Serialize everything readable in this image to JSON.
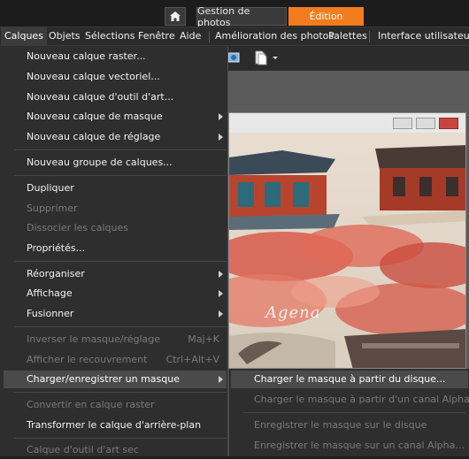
{
  "workspace_tabs": {
    "home_icon": "home-icon",
    "gestion": "Gestion de photos",
    "edition": "Édition"
  },
  "menubar": {
    "items": [
      "Calques",
      "Objets",
      "Sélections",
      "Fenêtre",
      "Aide",
      "Amélioration des photos",
      "Palettes",
      "Interface utilisateur"
    ]
  },
  "calques_menu": {
    "items": [
      {
        "label": "Nouveau calque raster..."
      },
      {
        "label": "Nouveau calque vectoriel..."
      },
      {
        "label": "Nouveau calque d'outil d'art..."
      },
      {
        "label": "Nouveau calque de masque"
      },
      {
        "label": "Nouveau calque de réglage"
      },
      {
        "label": "Nouveau groupe de calques..."
      },
      {
        "label": "Dupliquer"
      },
      {
        "label": "Supprimer"
      },
      {
        "label": "Dissocier les calques"
      },
      {
        "label": "Propriétés..."
      },
      {
        "label": "Réorganiser"
      },
      {
        "label": "Affichage"
      },
      {
        "label": "Fusionner"
      },
      {
        "label": "Inverser le masque/réglage",
        "shortcut": "Maj+K"
      },
      {
        "label": "Afficher le recouvrement",
        "shortcut": "Ctrl+Alt+V"
      },
      {
        "label": "Charger/enregistrer un masque"
      },
      {
        "label": "Convertir en calque raster"
      },
      {
        "label": "Transformer le calque d'arrière-plan"
      },
      {
        "label": "Calque d'outil d'art sec"
      }
    ]
  },
  "mask_submenu": {
    "items": [
      {
        "label": "Charger le masque à partir du disque..."
      },
      {
        "label": "Charger le masque à partir d'un canal Alpha..."
      },
      {
        "label": "Enregistrer le masque sur le disque"
      },
      {
        "label": "Enregistrer le masque sur un canal Alpha..."
      }
    ]
  },
  "image": {
    "watermark": "Agena",
    "title_buttons": [
      "minimize-icon",
      "restore-icon",
      "close-icon"
    ]
  },
  "colors": {
    "accent": "#f37c1f",
    "menu_bg": "#2e2e2e",
    "highlight": "#4a4a4a",
    "disabled_text": "#7a7a7a"
  }
}
